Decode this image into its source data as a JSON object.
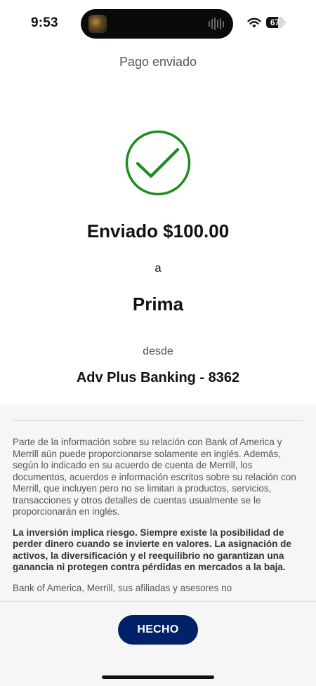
{
  "status_bar": {
    "time": "9:53",
    "battery_level": 67,
    "battery_label": "67",
    "icons": [
      "wifi-icon",
      "battery-icon",
      "now-playing-waveform-icon"
    ]
  },
  "header": {
    "title": "Pago enviado"
  },
  "confirmation": {
    "icon": "check-circle-icon",
    "icon_color": "#1e8c1e",
    "amount_line": "Enviado $100.00",
    "to_label": "a",
    "recipient": "Prima",
    "from_label": "desde",
    "account": "Adv Plus Banking - 8362"
  },
  "disclosure": {
    "paragraph_1": "Parte de la información sobre su relación con Bank of America y Merrill aún puede proporcionarse solamente en inglés. Además, según lo indicado en su acuerdo de cuenta de Merrill, los documentos, acuerdos e información escritos sobre su relación con Merrill, que incluyen pero no se limitan a productos, servicios, transacciones y otros detalles de cuentas usualmente se le proporcionarán en inglés.",
    "paragraph_2": "La inversión implica riesgo. Siempre existe la posibilidad de perder dinero cuando se invierte en valores. La asignación de activos, la diversificación y el reequilibrio no garantizan una ganancia ni protegen contra pérdidas en mercados a la baja.",
    "paragraph_3": "Bank of America, Merrill, sus afiliadas y asesores no"
  },
  "footer": {
    "done_label": "HECHO",
    "button_color": "#012169"
  }
}
